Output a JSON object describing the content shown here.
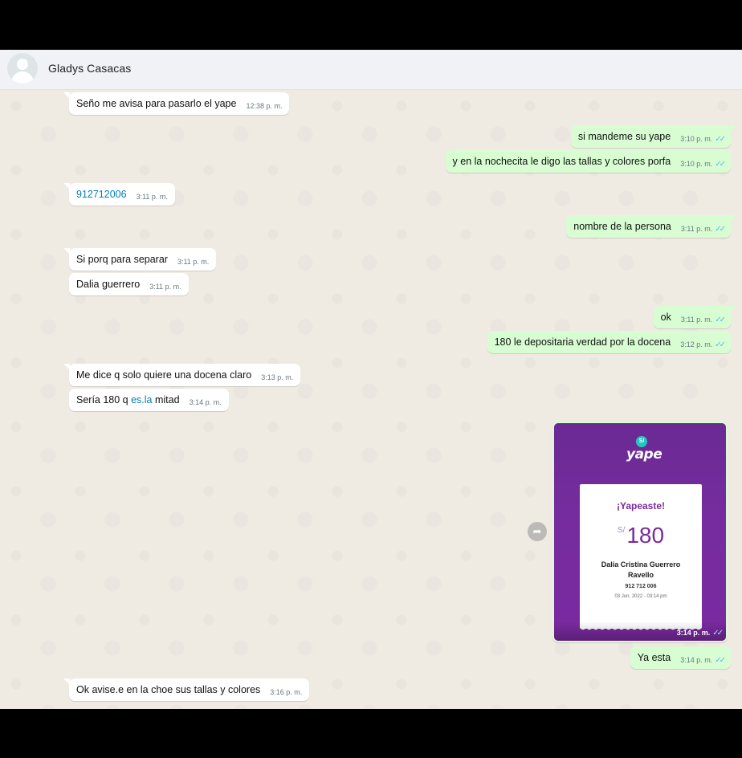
{
  "header": {
    "contact_name": "Gladys Casacas",
    "avatar_icon": "default-avatar-icon"
  },
  "messages": [
    {
      "dir": "in",
      "text": "Seño me avisa para pasarlo el yape",
      "time": "12:38 p. m."
    },
    {
      "dir": "out",
      "text": "si mandeme su yape",
      "time": "3:10 p. m."
    },
    {
      "dir": "out",
      "text": "y en la nochecita le digo las tallas y colores porfa",
      "time": "3:10 p. m."
    },
    {
      "dir": "in",
      "text": "912712006",
      "time": "3:11 p. m."
    },
    {
      "dir": "out",
      "text": "nombre de la persona",
      "time": "3:11 p. m."
    },
    {
      "dir": "in",
      "text": "Si porq para separar",
      "time": "3:11 p. m."
    },
    {
      "dir": "in",
      "text": "Dalia guerrero",
      "time": "3:11 p. m."
    },
    {
      "dir": "out",
      "text": "ok",
      "time": "3:11 p. m."
    },
    {
      "dir": "out",
      "text": "180 le depositaria verdad por la docena",
      "time": "3:12 p. m."
    },
    {
      "dir": "in",
      "text": "Me dice q solo quiere una docena claro",
      "time": "3:13 p. m."
    },
    {
      "dir": "in",
      "text_before": "Sería 180 q ",
      "link": "es.la",
      "text_after": " mitad",
      "time": "3:14 p. m."
    },
    {
      "dir": "out",
      "text": "Ya esta",
      "time": "3:14 p. m."
    },
    {
      "dir": "in",
      "text": "Ok avise.e en la choe sus tallas y colores",
      "time": "3:16 p. m."
    }
  ],
  "image_message": {
    "time": "3:14 p. m.",
    "brand_bubble": "S/",
    "brand": "yape",
    "receipt_title": "¡Yapeaste!",
    "currency": "S/",
    "amount": "180",
    "payee": "Dalia Cristina Guerrero Ravello",
    "phone": "912 712 006",
    "date": "03 Jun. 2022 - 03:14 pm"
  },
  "icons": {
    "read_ticks": "✓✓",
    "forward": "➦"
  },
  "colors": {
    "incoming_bubble": "#ffffff",
    "outgoing_bubble": "#d9fdd3",
    "chat_background": "#efeae2",
    "header_background": "#f0f2f5",
    "read_ticks": "#53bdeb",
    "link": "#027eb5",
    "yape_purple": "#742c9d"
  }
}
